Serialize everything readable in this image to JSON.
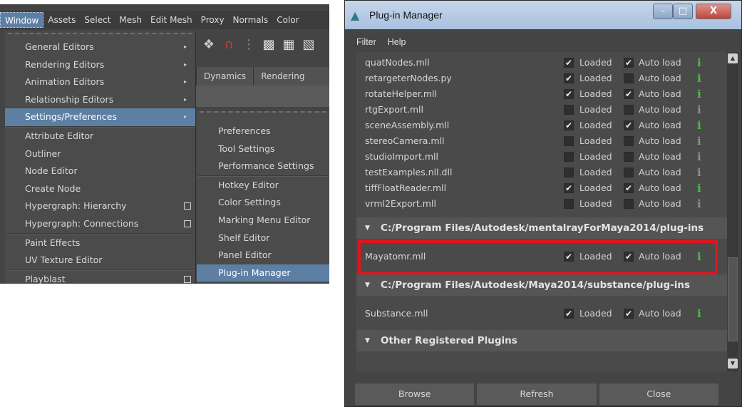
{
  "maya": {
    "menubar": [
      "Window",
      "Assets",
      "Select",
      "Mesh",
      "Edit Mesh",
      "Proxy",
      "Normals",
      "Color"
    ],
    "shelf_tabs": [
      "Dynamics",
      "Rendering"
    ],
    "window_menu": [
      {
        "label": "General Editors",
        "arrow": "▸"
      },
      {
        "label": "Rendering Editors",
        "arrow": "▸"
      },
      {
        "label": "Animation Editors",
        "arrow": "▸"
      },
      {
        "label": "Relationship Editors",
        "arrow": "▸"
      },
      {
        "label": "Settings/Preferences",
        "arrow": "▸"
      },
      {
        "label": "Attribute Editor"
      },
      {
        "label": "Outliner"
      },
      {
        "label": "Node Editor"
      },
      {
        "label": "Create Node"
      },
      {
        "label": "Hypergraph: Hierarchy"
      },
      {
        "label": "Hypergraph: Connections"
      },
      {
        "label": "Paint Effects"
      },
      {
        "label": "UV Texture Editor"
      },
      {
        "label": "Playblast"
      }
    ],
    "settings_submenu": [
      "Preferences",
      "Tool Settings",
      "Performance Settings",
      "Hotkey Editor",
      "Color Settings",
      "Marking Menu Editor",
      "Shelf Editor",
      "Panel Editor",
      "Plug-in Manager"
    ]
  },
  "plugin_manager": {
    "title": "Plug-in Manager",
    "window_buttons": {
      "minimize": "–",
      "maximize": "□",
      "close": "X"
    },
    "menus": [
      "Filter",
      "Help"
    ],
    "loaded_label": "Loaded",
    "autoload_label": "Auto load",
    "info_glyph": "i",
    "check_glyph": "✔",
    "plugins": [
      {
        "name": "quatNodes.mll",
        "loaded": true,
        "autoload": true
      },
      {
        "name": "retargeterNodes.py",
        "loaded": true,
        "autoload": false
      },
      {
        "name": "rotateHelper.mll",
        "loaded": true,
        "autoload": true
      },
      {
        "name": "rtgExport.mll",
        "loaded": false,
        "autoload": false
      },
      {
        "name": "sceneAssembly.mll",
        "loaded": true,
        "autoload": true
      },
      {
        "name": "stereoCamera.mll",
        "loaded": false,
        "autoload": false
      },
      {
        "name": "studioImport.mll",
        "loaded": false,
        "autoload": false
      },
      {
        "name": "testExamples.nll.dll",
        "loaded": false,
        "autoload": false
      },
      {
        "name": "tiffFloatReader.mll",
        "loaded": true,
        "autoload": true
      },
      {
        "name": "vrml2Export.mll",
        "loaded": false,
        "autoload": false
      }
    ],
    "sections": [
      {
        "title": "C:/Program Files/Autodesk/mentalrayForMaya2014/plug-ins",
        "plugins": [
          {
            "name": "Mayatomr.mll",
            "loaded": true,
            "autoload": true
          }
        ]
      },
      {
        "title": "C:/Program Files/Autodesk/Maya2014/substance/plug-ins",
        "plugins": [
          {
            "name": "Substance.mll",
            "loaded": true,
            "autoload": true
          }
        ]
      },
      {
        "title": "Other Registered Plugins",
        "plugins": []
      }
    ],
    "buttons": {
      "browse": "Browse",
      "refresh": "Refresh",
      "close": "Close"
    },
    "highlight_color": "#e1141c",
    "info_color_loaded": "#42c43a",
    "info_color_unloaded": "#8e8e8e"
  }
}
